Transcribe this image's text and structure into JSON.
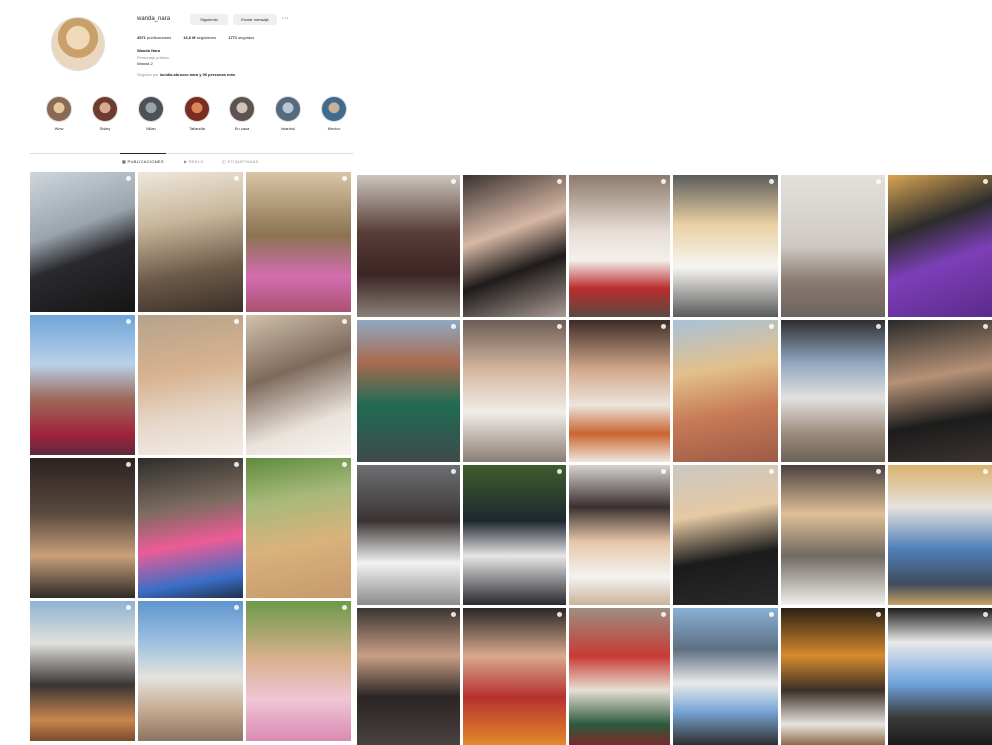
{
  "profile": {
    "username": "wanda_nara",
    "buttons": {
      "following": "Siguiendo",
      "message": "Enviar mensaje",
      "more": "···"
    },
    "stats": [
      {
        "value": "4571",
        "label": "publicaciones"
      },
      {
        "value": "16,6 M",
        "label": "seguidores"
      },
      {
        "value": "1771",
        "label": "seguidos"
      }
    ],
    "name": "Wanda Nara",
    "category": "Personaje público",
    "location": "Wanda 2",
    "followed_by_prefix": "Seguido por",
    "followed_by": "lucidia.abruzzo.nara y 96 personas más"
  },
  "highlights": [
    "Wow",
    "Sisley",
    "Milan",
    "Tailandia",
    "En casa",
    "Istanbul",
    "Mexico"
  ],
  "tabs": [
    {
      "label": "PUBLICACIONES",
      "icon": "grid-icon",
      "active": true
    },
    {
      "label": "REELS",
      "icon": "reels-icon",
      "active": false
    },
    {
      "label": "ETIQUETADAS",
      "icon": "tagged-icon",
      "active": false
    }
  ],
  "colors": {
    "accent": "#0095f6",
    "text": "#262626",
    "muted": "#8e8e8e",
    "border": "#dbdbdb"
  }
}
